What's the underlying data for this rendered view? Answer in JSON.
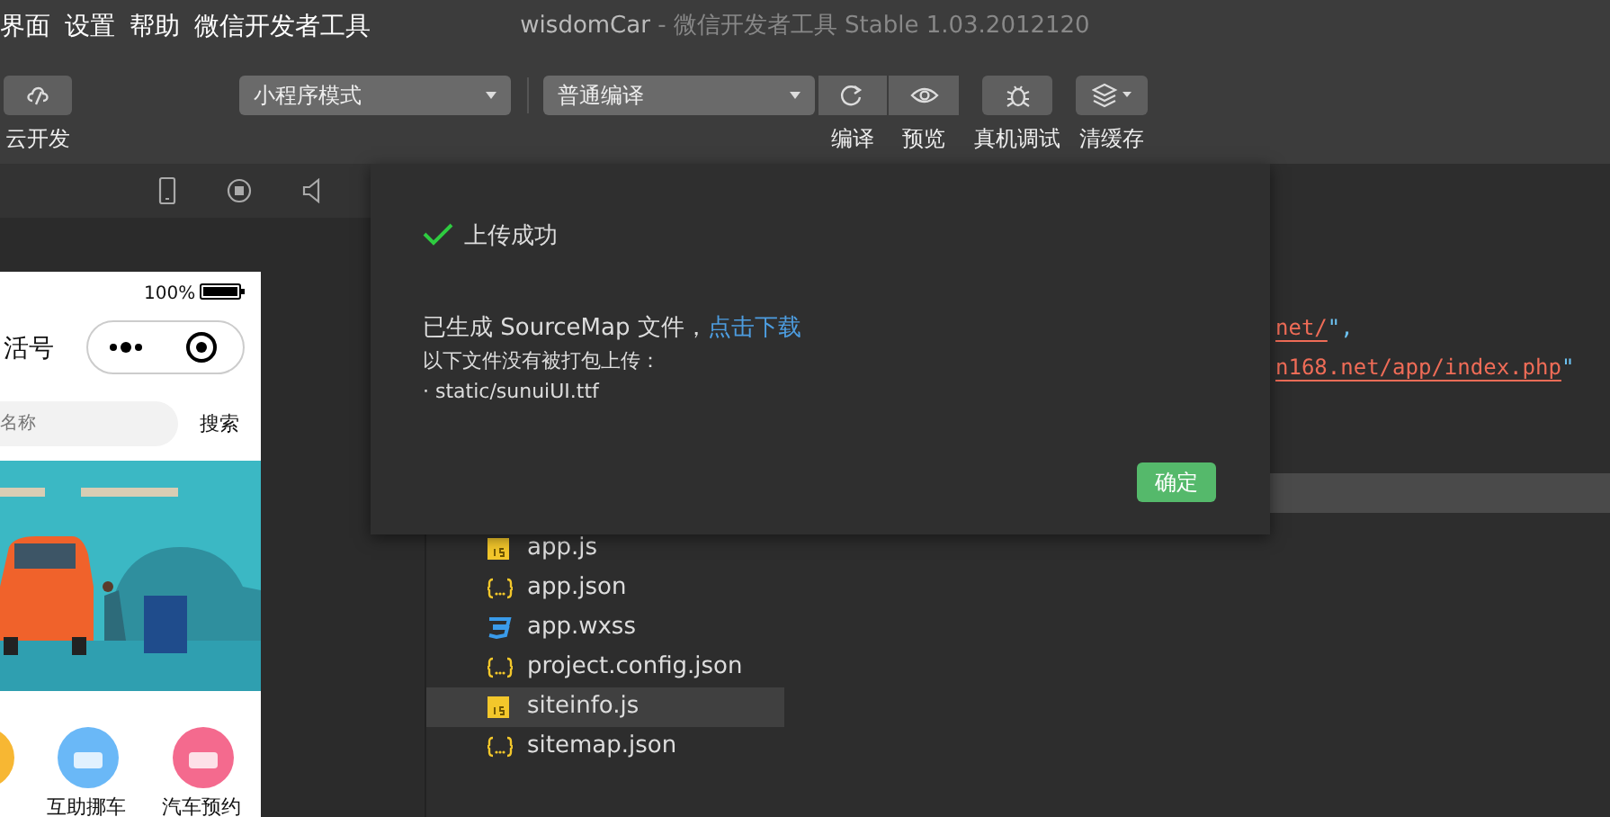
{
  "menu": [
    "界面",
    "设置",
    "帮助",
    "微信开发者工具"
  ],
  "window": {
    "title": "wisdomCar",
    "subtitle": "- 微信开发者工具 Stable 1.03.2012120"
  },
  "toolbar": {
    "cloud": {
      "label": "云开发"
    },
    "mode_select": {
      "value": "小程序模式"
    },
    "compile_select": {
      "value": "普通编译"
    },
    "actions": [
      {
        "label": "编译",
        "kind": "refresh"
      },
      {
        "label": "预览",
        "kind": "eye"
      },
      {
        "label": "真机调试",
        "kind": "bug"
      },
      {
        "label": "清缓存",
        "kind": "layers"
      }
    ]
  },
  "phone": {
    "battery": "100%",
    "title": "活号",
    "search_placeholder": "名称",
    "search_button": "搜索",
    "shortcuts": [
      {
        "label": "互助挪车",
        "color": "#6ab8f7"
      },
      {
        "label": "汽车预约",
        "color": "#f46a8e"
      }
    ]
  },
  "files": [
    {
      "name": "app.js",
      "kind": "js",
      "selected": false
    },
    {
      "name": "app.json",
      "kind": "json",
      "selected": false
    },
    {
      "name": "app.wxss",
      "kind": "css",
      "selected": false
    },
    {
      "name": "project.config.json",
      "kind": "json",
      "selected": false
    },
    {
      "name": "siteinfo.js",
      "kind": "js",
      "selected": true
    },
    {
      "name": "sitemap.json",
      "kind": "json",
      "selected": false
    }
  ],
  "code_lines": [
    {
      "string": "net/",
      "punct": "\","
    },
    {
      "string": "n168.net/app/index.php",
      "punct": "\""
    }
  ],
  "dialog": {
    "title": "上传成功",
    "message": "已生成 SourceMap 文件，",
    "link": "点击下载",
    "note": "以下文件没有被打包上传：",
    "files": [
      "· static/sunuiUI.ttf"
    ],
    "button": "确定"
  }
}
